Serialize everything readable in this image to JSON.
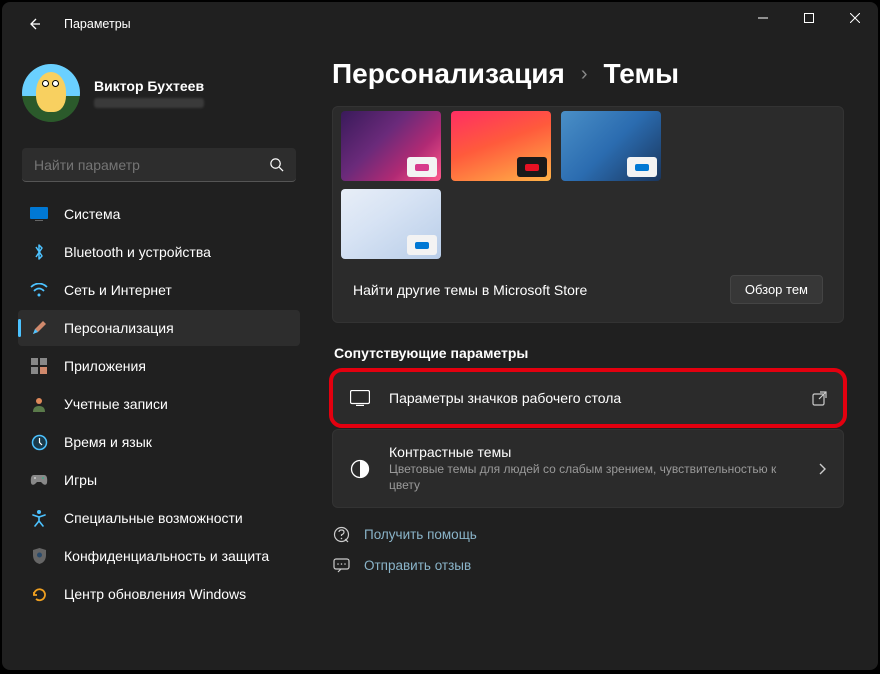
{
  "window": {
    "title": "Параметры"
  },
  "user": {
    "name": "Виктор Бухтеев"
  },
  "search": {
    "placeholder": "Найти параметр"
  },
  "nav": {
    "items": [
      {
        "label": "Система"
      },
      {
        "label": "Bluetooth и устройства"
      },
      {
        "label": "Сеть и Интернет"
      },
      {
        "label": "Персонализация"
      },
      {
        "label": "Приложения"
      },
      {
        "label": "Учетные записи"
      },
      {
        "label": "Время и язык"
      },
      {
        "label": "Игры"
      },
      {
        "label": "Специальные возможности"
      },
      {
        "label": "Конфиденциальность и защита"
      },
      {
        "label": "Центр обновления Windows"
      }
    ],
    "active_index": 3
  },
  "breadcrumb": {
    "root": "Персонализация",
    "leaf": "Темы"
  },
  "store": {
    "text": "Найти другие темы в Microsoft Store",
    "button": "Обзор тем"
  },
  "section": {
    "related": "Сопутствующие параметры"
  },
  "rows": {
    "desktop_icons": {
      "title": "Параметры значков рабочего стола"
    },
    "contrast": {
      "title": "Контрастные темы",
      "sub": "Цветовые темы для людей со слабым зрением, чувствительностью к цвету"
    }
  },
  "links": {
    "help": "Получить помощь",
    "feedback": "Отправить отзыв"
  },
  "themes": [
    {
      "accent": "#d73a8c",
      "bg1": "#391a5a",
      "bg2": "#b12a74",
      "overlay": "light"
    },
    {
      "accent": "#e81123",
      "bg1": "#ff2e63",
      "bg2": "#ffb347",
      "overlay": "dark"
    },
    {
      "accent": "#0078d4",
      "bg1": "#2b6cb0",
      "bg2": "#1a365d",
      "overlay": "light"
    },
    {
      "accent": "#0078d4",
      "bg1": "#d7e3f4",
      "bg2": "#b8cde8",
      "overlay": "light"
    }
  ]
}
